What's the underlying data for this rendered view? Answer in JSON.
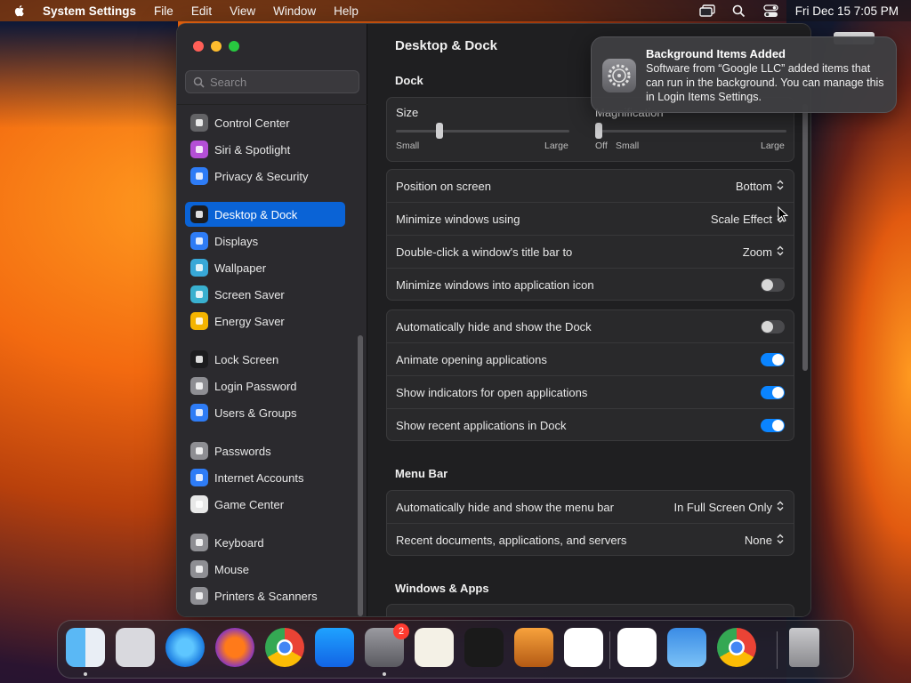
{
  "menubar": {
    "app_name": "System Settings",
    "menus": [
      "File",
      "Edit",
      "View",
      "Window",
      "Help"
    ],
    "date_time": "Fri Dec 15  7:05 PM"
  },
  "sidebar": {
    "search_placeholder": "Search",
    "items": [
      {
        "label": "Control Center",
        "icon": "control-center-icon",
        "color": "#636366"
      },
      {
        "label": "Siri & Spotlight",
        "icon": "siri-icon",
        "color": "#b44fd6"
      },
      {
        "label": "Privacy & Security",
        "icon": "hand-icon",
        "color": "#2e7cf6"
      },
      {
        "label": "Desktop & Dock",
        "icon": "dock-icon",
        "color": "#1c1c1e",
        "selected": true
      },
      {
        "label": "Displays",
        "icon": "sun-icon",
        "color": "#2e7cf6"
      },
      {
        "label": "Wallpaper",
        "icon": "flower-icon",
        "color": "#38a8d8"
      },
      {
        "label": "Screen Saver",
        "icon": "screen-saver-icon",
        "color": "#39b0cf"
      },
      {
        "label": "Energy Saver",
        "icon": "bulb-icon",
        "color": "#f4b400"
      },
      {
        "label": "Lock Screen",
        "icon": "lock-icon",
        "color": "#1c1c1e"
      },
      {
        "label": "Login Password",
        "icon": "key-icon",
        "color": "#8e8e93"
      },
      {
        "label": "Users & Groups",
        "icon": "users-icon",
        "color": "#2e7cf6"
      },
      {
        "label": "Passwords",
        "icon": "key-icon",
        "color": "#8e8e93"
      },
      {
        "label": "Internet Accounts",
        "icon": "at-icon",
        "color": "#2e7cf6"
      },
      {
        "label": "Game Center",
        "icon": "game-center-icon",
        "color": "#e8e8e8"
      },
      {
        "label": "Keyboard",
        "icon": "keyboard-icon",
        "color": "#8e8e93"
      },
      {
        "label": "Mouse",
        "icon": "mouse-icon",
        "color": "#8e8e93"
      },
      {
        "label": "Printers & Scanners",
        "icon": "printer-icon",
        "color": "#8e8e93"
      }
    ]
  },
  "main": {
    "title": "Desktop & Dock",
    "dock_section": "Dock",
    "size": {
      "label": "Size",
      "min_label": "Small",
      "max_label": "Large",
      "value": 0.25
    },
    "magnification": {
      "label": "Magnification",
      "off_label": "Off",
      "min_label": "Small",
      "max_label": "Large",
      "value": 0.0
    },
    "rows_group1": [
      {
        "label": "Position on screen",
        "type": "popup",
        "value": "Bottom"
      },
      {
        "label": "Minimize windows using",
        "type": "popup",
        "value": "Scale Effect"
      },
      {
        "label": "Double-click a window's title bar to",
        "type": "popup",
        "value": "Zoom"
      },
      {
        "label": "Minimize windows into application icon",
        "type": "toggle",
        "on": false
      }
    ],
    "rows_group2": [
      {
        "label": "Automatically hide and show the Dock",
        "type": "toggle",
        "on": false
      },
      {
        "label": "Animate opening applications",
        "type": "toggle",
        "on": true
      },
      {
        "label": "Show indicators for open applications",
        "type": "toggle",
        "on": true
      },
      {
        "label": "Show recent applications in Dock",
        "type": "toggle",
        "on": true
      }
    ],
    "menubar_section": "Menu Bar",
    "rows_group3": [
      {
        "label": "Automatically hide and show the menu bar",
        "type": "popup",
        "value": "In Full Screen Only"
      },
      {
        "label": "Recent documents, applications, and servers",
        "type": "popup",
        "value": "None"
      }
    ],
    "windows_section": "Windows & Apps"
  },
  "notification": {
    "title": "Background Items Added",
    "body": "Software from “Google LLC” added items that can run in the background. You can manage this in Login Items Settings."
  },
  "dock": {
    "apps": [
      {
        "name": "finder",
        "running": true
      },
      {
        "name": "launchpad",
        "running": false
      },
      {
        "name": "safari",
        "running": false
      },
      {
        "name": "firefox",
        "running": false
      },
      {
        "name": "chrome",
        "running": false
      },
      {
        "name": "app-store",
        "running": false
      },
      {
        "name": "system-settings",
        "running": true,
        "badge": "2"
      },
      {
        "name": "textedit",
        "running": false
      },
      {
        "name": "terminal",
        "running": false
      },
      {
        "name": "garageband",
        "running": false
      },
      {
        "name": "vscode",
        "running": false
      },
      {
        "name": "visual-studio",
        "running": false
      },
      {
        "name": "weather",
        "running": false
      },
      {
        "name": "chrome-recent",
        "running": false
      },
      {
        "name": "trash",
        "running": false
      }
    ]
  }
}
